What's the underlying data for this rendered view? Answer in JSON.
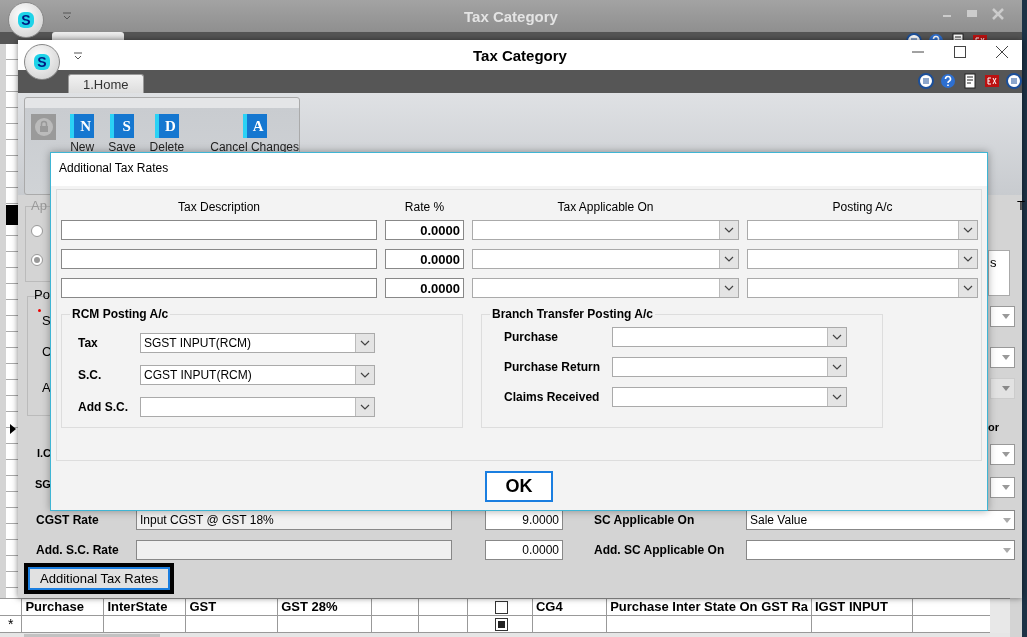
{
  "back_window": {
    "title": "Tax Category",
    "logo_letter": "S",
    "table": {
      "rows": [
        {
          "cells": [
            {
              "kind": "text",
              "text": "Purchase"
            },
            {
              "kind": "text",
              "text": "InterState"
            },
            {
              "kind": "text",
              "text": "GST"
            },
            {
              "kind": "text",
              "text": "GST 28%"
            },
            {
              "kind": "blank"
            },
            {
              "kind": "blank"
            },
            {
              "kind": "checkbox",
              "checked": false
            },
            {
              "kind": "text",
              "text": "CG4"
            },
            {
              "kind": "text",
              "text": "Purchase Inter State On GST Ra"
            },
            {
              "kind": "text",
              "text": "IGST INPUT"
            },
            {
              "kind": "blank"
            }
          ]
        },
        {
          "marker": "*",
          "cells": [
            {
              "kind": "blank"
            },
            {
              "kind": "blank"
            },
            {
              "kind": "blank"
            },
            {
              "kind": "blank"
            },
            {
              "kind": "blank"
            },
            {
              "kind": "blank"
            },
            {
              "kind": "checkbox",
              "checked": true
            },
            {
              "kind": "blank"
            },
            {
              "kind": "blank"
            },
            {
              "kind": "blank"
            },
            {
              "kind": "blank"
            }
          ]
        }
      ]
    }
  },
  "front_window": {
    "title": "Tax Category",
    "logo_letter": "S",
    "tabs": [
      {
        "label": "1.Home",
        "selected": true
      }
    ],
    "ribbon_buttons": [
      {
        "label": "New",
        "glyph": "N"
      },
      {
        "label": "Save",
        "glyph": "S"
      },
      {
        "label": "Delete",
        "glyph": "D"
      },
      {
        "label": "Cancel Changes",
        "glyph": "A"
      }
    ],
    "radios": [
      {
        "selected": false
      },
      {
        "selected": true
      }
    ],
    "covered_labels": [
      {
        "text": "Ap"
      },
      {
        "text": "Po"
      },
      {
        "text": "S"
      },
      {
        "text": "C"
      },
      {
        "text": "A"
      },
      {
        "text": "I.C"
      },
      {
        "text": "SG"
      },
      {
        "text": "T"
      },
      {
        "text": "s"
      },
      {
        "text": "or"
      }
    ],
    "rate_rows": [
      {
        "label": "CGST Rate",
        "account": "Input CGST @ GST 18%",
        "rate": "9.0000",
        "applicable_label": "SC Applicable On",
        "applicable": "Sale Value"
      },
      {
        "label": "Add. S.C. Rate",
        "rate": "0.0000",
        "applicable_label": "Add. SC Applicable On"
      }
    ],
    "additional_button": {
      "label": "Additional Tax Rates",
      "focused": true
    }
  },
  "dialog": {
    "title": "Additional Tax Rates",
    "columns": [
      "Tax Description",
      "Rate %",
      "Tax Applicable On",
      "Posting A/c"
    ],
    "rows": [
      {
        "rate": "0.0000"
      },
      {
        "rate": "0.0000"
      },
      {
        "rate": "0.0000"
      }
    ],
    "rcm": {
      "title": "RCM Posting A/c",
      "fields": [
        {
          "label": "Tax",
          "value": "SGST INPUT(RCM)"
        },
        {
          "label": "S.C.",
          "value": "CGST INPUT(RCM)"
        },
        {
          "label": "Add S.C."
        }
      ]
    },
    "branch": {
      "title": "Branch Transfer Posting A/c",
      "fields": [
        {
          "label": "Purchase"
        },
        {
          "label": "Purchase Return"
        },
        {
          "label": "Claims Received"
        }
      ]
    },
    "ok_label": "OK"
  }
}
